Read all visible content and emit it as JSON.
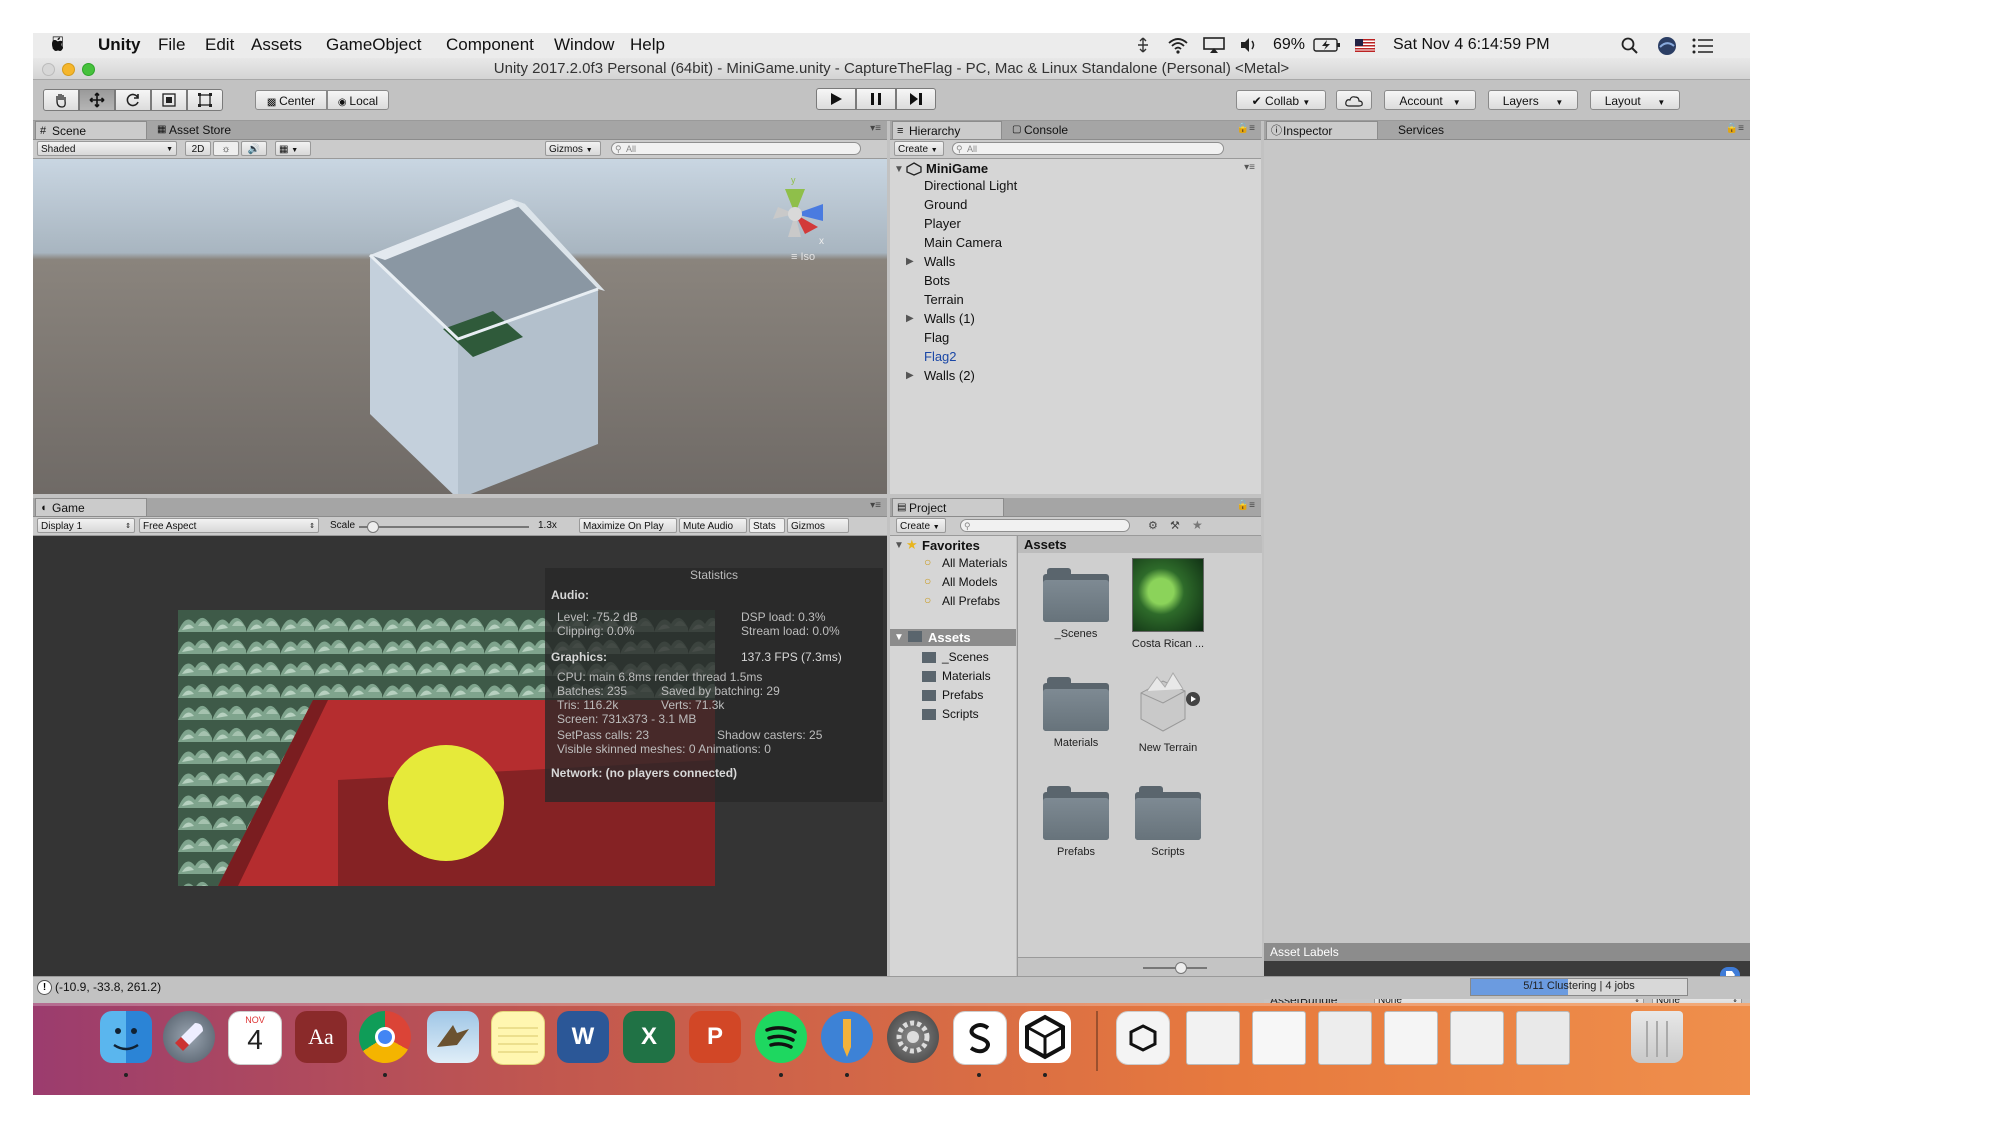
{
  "menubar": {
    "apple": "",
    "items": [
      "Unity",
      "File",
      "Edit",
      "Assets",
      "GameObject",
      "Component",
      "Window",
      "Help"
    ],
    "battery": "69%",
    "datetime": "Sat Nov 4  6:14:59 PM"
  },
  "window": {
    "title": "Unity 2017.2.0f3 Personal (64bit) - MiniGame.unity - CaptureTheFlag - PC, Mac & Linux Standalone (Personal) <Metal>"
  },
  "toolbar": {
    "center_label": "Center",
    "local_label": "Local",
    "collab_label": "Collab",
    "account_label": "Account",
    "layers_label": "Layers",
    "layout_label": "Layout"
  },
  "scene": {
    "tab_scene": "Scene",
    "tab_asset_store": "Asset Store",
    "shading_mode": "Shaded",
    "mode_2d": "2D",
    "gizmos_label": "Gizmos",
    "search_placeholder": "All",
    "iso_label": "Iso",
    "axis_y": "y",
    "axis_x": "x"
  },
  "hierarchy": {
    "tab_hierarchy": "Hierarchy",
    "tab_console": "Console",
    "create_label": "Create",
    "search_placeholder": "All",
    "scene_name": "MiniGame",
    "items": [
      {
        "label": "Directional Light",
        "expandable": false,
        "selected": false
      },
      {
        "label": "Ground",
        "expandable": false,
        "selected": false
      },
      {
        "label": "Player",
        "expandable": false,
        "selected": false
      },
      {
        "label": "Main Camera",
        "expandable": false,
        "selected": false
      },
      {
        "label": "Walls",
        "expandable": true,
        "selected": false
      },
      {
        "label": "Bots",
        "expandable": false,
        "selected": false
      },
      {
        "label": "Terrain",
        "expandable": false,
        "selected": false
      },
      {
        "label": "Walls (1)",
        "expandable": true,
        "selected": false
      },
      {
        "label": "Flag",
        "expandable": false,
        "selected": false
      },
      {
        "label": "Flag2",
        "expandable": false,
        "selected": true
      },
      {
        "label": "Walls (2)",
        "expandable": true,
        "selected": false
      }
    ]
  },
  "inspector": {
    "tab_inspector": "Inspector",
    "tab_services": "Services",
    "asset_labels": "Asset Labels",
    "assetbundle_label": "AssetBundle",
    "bundle_value": "None",
    "variant_value": "None"
  },
  "game": {
    "tab_game": "Game",
    "display": "Display 1",
    "aspect": "Free Aspect",
    "scale_label": "Scale",
    "scale_value": 1.3,
    "scale_text": "1.3x",
    "maximize_on_play": "Maximize On Play",
    "mute_audio": "Mute Audio",
    "stats": "Stats",
    "gizmos": "Gizmos"
  },
  "statistics": {
    "title": "Statistics",
    "audio_header": "Audio:",
    "level": "Level: -75.2 dB",
    "dsp_load": "DSP load: 0.3%",
    "clipping": "Clipping: 0.0%",
    "stream_load": "Stream load: 0.0%",
    "graphics_header": "Graphics:",
    "fps": "137.3 FPS (7.3ms)",
    "cpu": "CPU: main 6.8ms  render thread 1.5ms",
    "batches": "Batches: 235",
    "saved_by_batching": "Saved by batching: 29",
    "tris": "Tris: 116.2k",
    "verts": "Verts: 71.3k",
    "screen": "Screen: 731x373 - 3.1 MB",
    "setpass": "SetPass calls: 23",
    "shadow_casters": "Shadow casters: 25",
    "skinned": "Visible skinned meshes: 0  Animations: 0",
    "network": "Network: (no players connected)"
  },
  "project": {
    "tab_project": "Project",
    "create_label": "Create",
    "favorites_label": "Favorites",
    "favorites": [
      "All Materials",
      "All Models",
      "All Prefabs"
    ],
    "assets_label": "Assets",
    "folders": [
      "_Scenes",
      "Materials",
      "Prefabs",
      "Scripts"
    ],
    "grid_header": "Assets",
    "grid_items": [
      {
        "label": "_Scenes",
        "kind": "folder"
      },
      {
        "label": "Costa Rican ...",
        "kind": "image"
      },
      {
        "label": "Materials",
        "kind": "folder"
      },
      {
        "label": "New Terrain",
        "kind": "terrain"
      },
      {
        "label": "Prefabs",
        "kind": "folder"
      },
      {
        "label": "Scripts",
        "kind": "folder"
      }
    ]
  },
  "statusbar": {
    "message": "(-10.9, -33.8, 261.2)",
    "progress_text": "5/11 Clustering | 4 jobs",
    "progress_fraction": 0.45
  },
  "dock": {
    "calendar_month": "NOV",
    "calendar_day": "4",
    "dictionary": "Aa",
    "word": "W",
    "excel": "X",
    "powerpoint": "P"
  },
  "colors": {
    "selected_item": "#1a47a6",
    "game_background": "#343434",
    "player_ball": "#e6ea3a",
    "red_floor": "#b52d2f",
    "dock_gradient_start": "#b3476b",
    "dock_gradient_end": "#f08a4a"
  }
}
